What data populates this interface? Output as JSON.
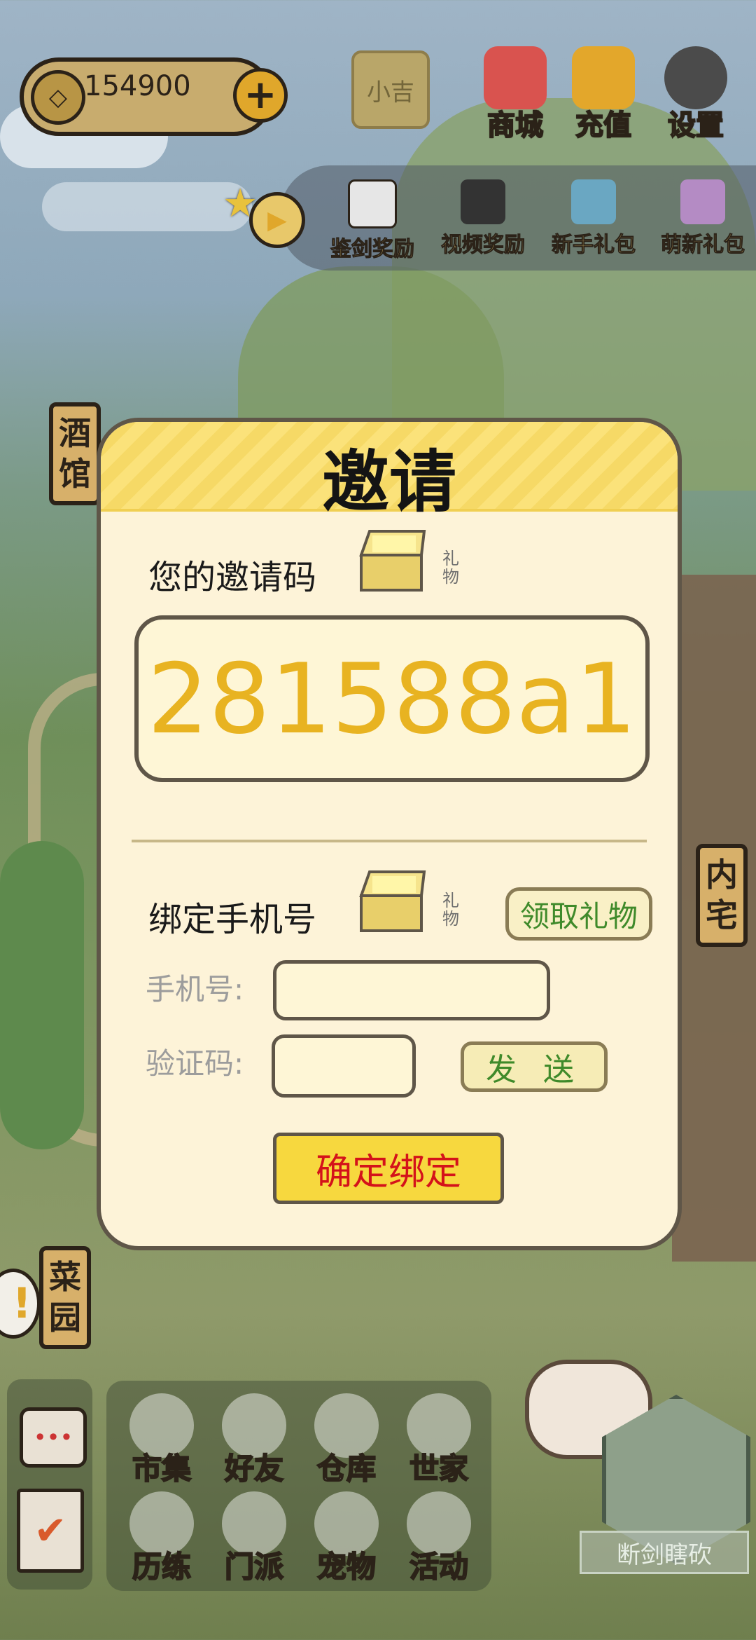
{
  "top_bar": {
    "coins": "154900",
    "coin_symbol": "◇",
    "plus_label": "+",
    "xiaoji_label": "小吉",
    "icons": [
      {
        "label": "商城",
        "icon": "shop-bag-icon",
        "color": "#d9534f"
      },
      {
        "label": "充值",
        "icon": "gold-ingot-icon",
        "color": "#e3a72b"
      },
      {
        "label": "设置",
        "icon": "gear-icon",
        "color": "#4b4b4b"
      }
    ]
  },
  "rewards": {
    "play_symbol": "▶",
    "star_symbol": "★",
    "items": [
      {
        "label": "鉴剑奖励",
        "icon": "calendar-icon",
        "color": "#e6e6e6"
      },
      {
        "label": "视频奖励",
        "icon": "clapperboard-icon",
        "color": "#333333"
      },
      {
        "label": "新手礼包",
        "icon": "treasure-chest-icon",
        "color": "#6aa7c2"
      },
      {
        "label": "萌新礼包",
        "icon": "gift-box-icon",
        "color": "#b48bc4"
      }
    ]
  },
  "side_signs": {
    "tavern": "酒馆",
    "inner_house": "内宅",
    "garden": "菜园"
  },
  "dialog": {
    "title": "邀请",
    "my_code_label": "您的邀请码",
    "gift_text": "礼物",
    "invite_code": "281588a1",
    "bind_phone_label": "绑定手机号",
    "claim_gift_button": "领取礼物",
    "phone_label": "手机号:",
    "phone_value": "",
    "code_label": "验证码:",
    "code_value": "",
    "send_button": "发 送",
    "confirm_button": "确定绑定"
  },
  "bottom_menu": {
    "chat_icon_text": "•••",
    "task_icon_text": "✔",
    "items": [
      {
        "label": "市集",
        "icon": "market-icon"
      },
      {
        "label": "好友",
        "icon": "handshake-icon"
      },
      {
        "label": "仓库",
        "icon": "warehouse-chest-icon"
      },
      {
        "label": "世家",
        "icon": "clan-robe-icon"
      },
      {
        "label": "历练",
        "icon": "crossed-swords-icon"
      },
      {
        "label": "门派",
        "icon": "sect-banner-icon"
      },
      {
        "label": "宠物",
        "icon": "paw-icon"
      },
      {
        "label": "活动",
        "icon": "lantern-icon"
      }
    ]
  },
  "avatar": {
    "name": "断剑瞎砍"
  },
  "alert_symbol": "!"
}
